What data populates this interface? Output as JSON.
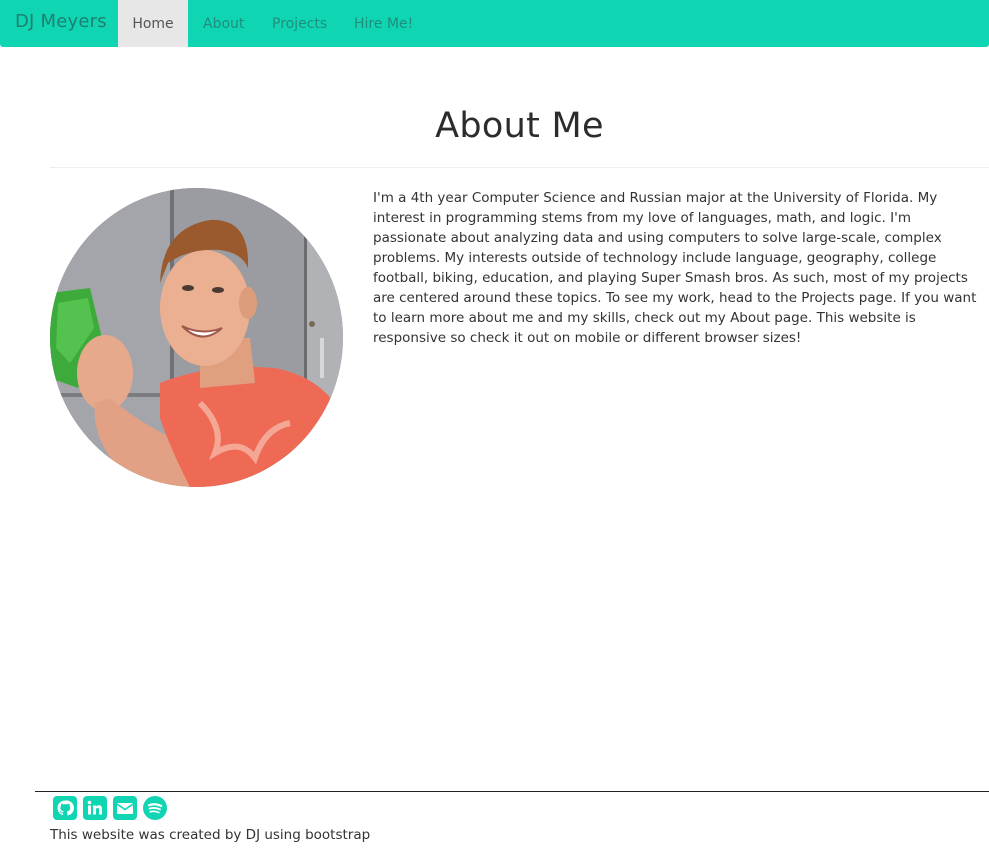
{
  "navbar": {
    "brand": "DJ Meyers",
    "items": [
      {
        "label": "Home",
        "active": true
      },
      {
        "label": "About",
        "active": false
      },
      {
        "label": "Projects",
        "active": false
      },
      {
        "label": "Hire Me!",
        "active": false
      }
    ]
  },
  "main": {
    "title": "About Me",
    "bio": "I'm a 4th year Computer Science and Russian major at the University of Florida. My interest in programming stems from my love of languages, math, and logic. I'm passionate about analyzing data and using computers to solve large-scale, complex problems. My interests outside of technology include language, geography, college football, biking, education, and playing Super Smash bros. As such, most of my projects are centered around these topics. To see my work, head to the Projects page. If you want to learn more about me and my skills, check out my About page. This website is responsive so check it out on mobile or different browser sizes!"
  },
  "footer": {
    "social_icons": [
      "github-icon",
      "linkedin-icon",
      "email-icon",
      "spotify-icon"
    ],
    "text": "This website was created by DJ using bootstrap"
  },
  "colors": {
    "accent": "#0fd5b3",
    "nav_text": "#1f8e7c",
    "active_tab": "#e7e7e7"
  }
}
